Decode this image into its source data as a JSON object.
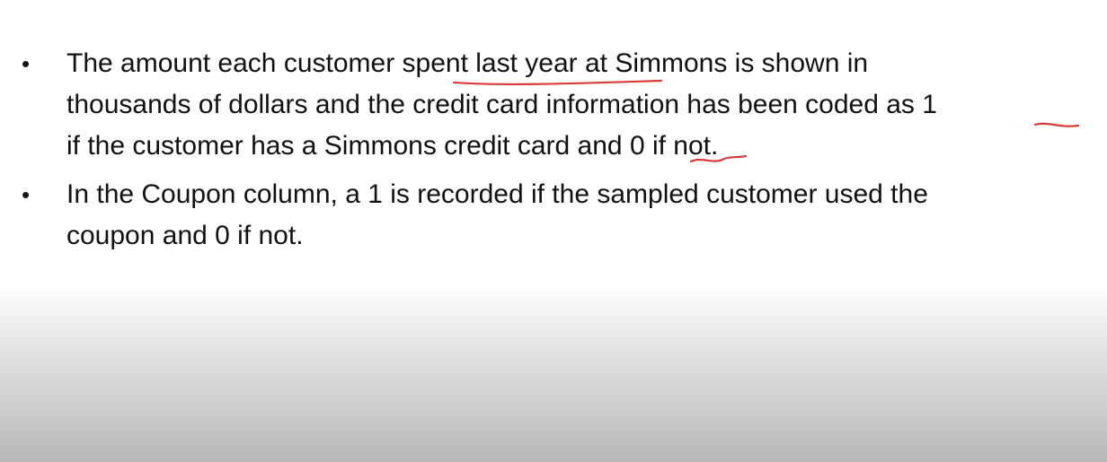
{
  "slide": {
    "bullets": [
      {
        "marker": "•",
        "lines": [
          "The amount each customer spent last year at Simmons is shown in",
          "thousands of dollars and the credit card information has been coded as 1",
          "if the customer has a Simmons credit card and 0 if not."
        ]
      },
      {
        "marker": "•",
        "lines": [
          " In the Coupon column, a 1 is recorded if the sampled customer used the",
          "coupon and 0 if not."
        ]
      }
    ]
  },
  "annotations": {
    "ink_color": "#d93b3b"
  }
}
